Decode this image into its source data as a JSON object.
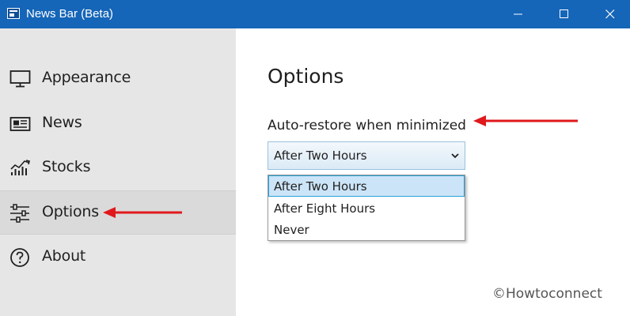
{
  "window": {
    "title": "News Bar (Beta)"
  },
  "sidebar": {
    "items": [
      {
        "label": "Appearance",
        "icon": "monitor-icon"
      },
      {
        "label": "News",
        "icon": "newspaper-icon"
      },
      {
        "label": "Stocks",
        "icon": "chart-trend-icon"
      },
      {
        "label": "Options",
        "icon": "sliders-icon",
        "selected": true
      },
      {
        "label": "About",
        "icon": "question-circle-icon"
      }
    ]
  },
  "main": {
    "title": "Options",
    "auto_restore": {
      "label": "Auto-restore when minimized",
      "selected_value": "After Two Hours",
      "options": [
        "After Two Hours",
        "After Eight Hours",
        "Never"
      ],
      "highlighted_option": "After Two Hours"
    }
  },
  "watermark": "©Howtoconnect",
  "colors": {
    "titlebar": "#1565b8",
    "sidebar": "#e6e6e6",
    "annotation_arrow": "#e0191c",
    "highlight": "#cce4f7"
  }
}
